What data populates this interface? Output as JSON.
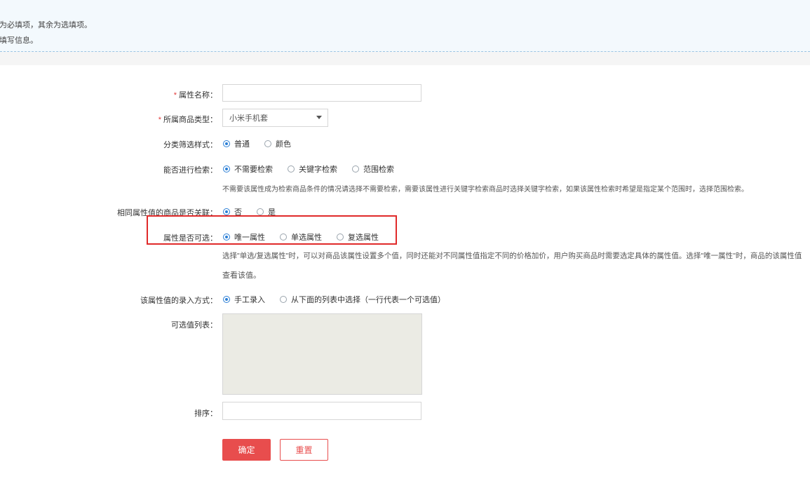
{
  "notice": {
    "line1": "为必填项，其余为选填项。",
    "line2": "填写信息。"
  },
  "form": {
    "required_mark": "*",
    "attr_name": {
      "label": "属性名称：",
      "value": ""
    },
    "goods_type": {
      "label": "所属商品类型：",
      "selected": "小米手机套"
    },
    "filter_style": {
      "label": "分类筛选样式：",
      "options": [
        "普通",
        "颜色"
      ],
      "selected_index": 0
    },
    "searchable": {
      "label": "能否进行检索：",
      "options": [
        "不需要检索",
        "关键字检索",
        "范围检索"
      ],
      "selected_index": 0,
      "hint": "不需要该属性成为检索商品条件的情况请选择不需要检索，需要该属性进行关键字检索商品时选择关键字检索，如果该属性检索时希望是指定某个范围时，选择范围检索。"
    },
    "linked": {
      "label": "相同属性值的商品是否关联：",
      "options": [
        "否",
        "是"
      ],
      "selected_index": 0
    },
    "selectable": {
      "label": "属性是否可选：",
      "options": [
        "唯一属性",
        "单选属性",
        "复选属性"
      ],
      "selected_index": 0,
      "hint_line1": "选择\"单选/复选属性\"时，可以对商品该属性设置多个值，同时还能对不同属性值指定不同的价格加价，用户购买商品时需要选定具体的属性值。选择\"唯一属性\"时，商品的该属性值",
      "hint_line2": "查看该值。"
    },
    "input_type": {
      "label": "该属性值的录入方式：",
      "options": [
        "手工录入",
        "从下面的列表中选择（一行代表一个可选值）"
      ],
      "selected_index": 0
    },
    "values_list": {
      "label": "可选值列表：",
      "value": ""
    },
    "sort": {
      "label": "排序：",
      "value": ""
    }
  },
  "buttons": {
    "confirm": "确定",
    "reset": "重置"
  },
  "colors": {
    "accent": "#e84d4d",
    "radio": "#2b7fd6",
    "highlight": "#e02a2a",
    "notice_bg": "#f3f9fd"
  }
}
